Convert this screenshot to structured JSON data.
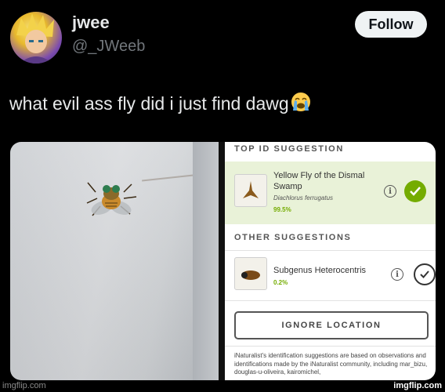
{
  "post": {
    "display_name": "jwee",
    "handle": "@_JWeeb",
    "follow_label": "Follow",
    "text": "what evil ass fly did i just find dawg"
  },
  "inaturalist": {
    "top_heading": "TOP ID SUGGESTION",
    "top": {
      "name": "Yellow Fly of the Dismal Swamp",
      "scientific": "Diachlorus ferrugatus",
      "score": "99.5%"
    },
    "other_heading": "OTHER SUGGESTIONS",
    "other": [
      {
        "name": "Subgenus Heterocentris",
        "score": "0.2%"
      }
    ],
    "ignore_label": "IGNORE LOCATION",
    "disclaimer": "iNaturalist's identification suggestions are based on observations and identifications made by the iNaturalist community, including mar_bizu, douglas-u-oliveira, kairomichel,"
  },
  "watermarks": {
    "left": "imgflip.com",
    "right": "imgflip.com"
  },
  "colors": {
    "accent_green": "#74ac00",
    "top_card_bg": "#e9f2d8"
  }
}
